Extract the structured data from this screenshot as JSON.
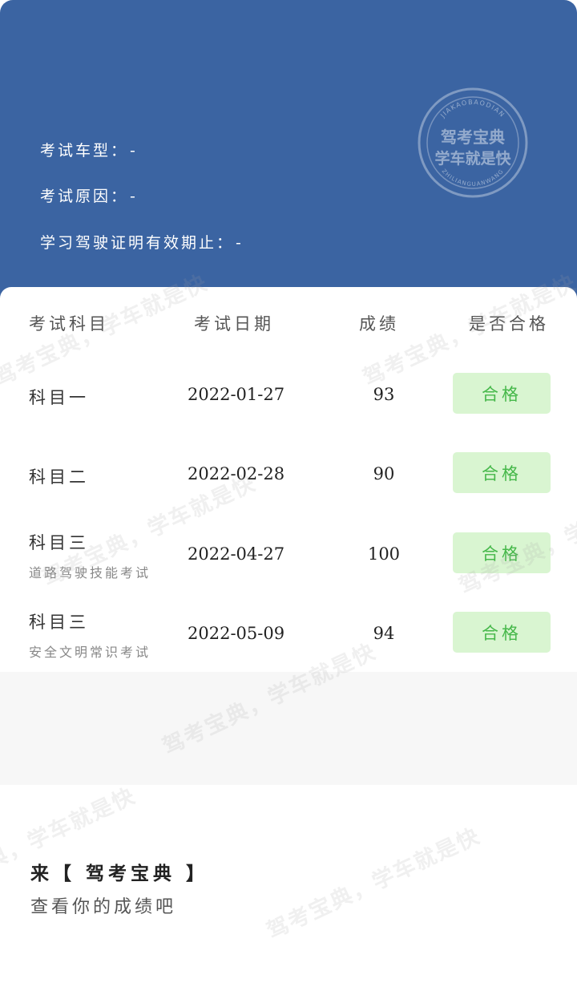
{
  "header": {
    "vehicle_label": "考试车型：",
    "vehicle_value": "-",
    "reason_label": "考试原因：",
    "reason_value": "-",
    "validity_label": "学习驾驶证明有效期止：",
    "validity_value": "-",
    "stamp": {
      "top_text": "JIAKAOBAODIAN",
      "line1": "驾考宝典",
      "line2": "学车就是快",
      "bottom_text": "ZHILIANGUANWANG"
    }
  },
  "table": {
    "headers": [
      "考试科目",
      "考试日期",
      "成绩",
      "是否合格"
    ],
    "rows": [
      {
        "subject": "科目一",
        "sub": "",
        "date": "2022-01-27",
        "score": "93",
        "result": "合格"
      },
      {
        "subject": "科目二",
        "sub": "",
        "date": "2022-02-28",
        "score": "90",
        "result": "合格"
      },
      {
        "subject": "科目三",
        "sub": "道路驾驶技能考试",
        "date": "2022-04-27",
        "score": "100",
        "result": "合格"
      },
      {
        "subject": "科目三",
        "sub": "安全文明常识考试",
        "date": "2022-05-09",
        "score": "94",
        "result": "合格"
      }
    ]
  },
  "promo": {
    "title": "来【 驾考宝典 】",
    "subtitle": "查看你的成绩吧"
  },
  "watermark": "驾考宝典，学车就是快",
  "colors": {
    "header_bg": "#3b64a2",
    "pass_bg": "#d9f5d1",
    "pass_text": "#46b84a"
  }
}
